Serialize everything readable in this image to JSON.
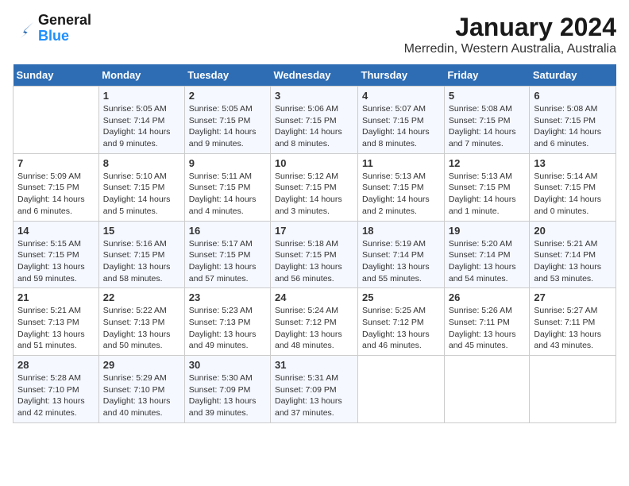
{
  "header": {
    "logo_line1": "General",
    "logo_line2": "Blue",
    "title": "January 2024",
    "subtitle": "Merredin, Western Australia, Australia"
  },
  "days_of_week": [
    "Sunday",
    "Monday",
    "Tuesday",
    "Wednesday",
    "Thursday",
    "Friday",
    "Saturday"
  ],
  "weeks": [
    [
      {
        "num": "",
        "info": ""
      },
      {
        "num": "1",
        "info": "Sunrise: 5:05 AM\nSunset: 7:14 PM\nDaylight: 14 hours\nand 9 minutes."
      },
      {
        "num": "2",
        "info": "Sunrise: 5:05 AM\nSunset: 7:15 PM\nDaylight: 14 hours\nand 9 minutes."
      },
      {
        "num": "3",
        "info": "Sunrise: 5:06 AM\nSunset: 7:15 PM\nDaylight: 14 hours\nand 8 minutes."
      },
      {
        "num": "4",
        "info": "Sunrise: 5:07 AM\nSunset: 7:15 PM\nDaylight: 14 hours\nand 8 minutes."
      },
      {
        "num": "5",
        "info": "Sunrise: 5:08 AM\nSunset: 7:15 PM\nDaylight: 14 hours\nand 7 minutes."
      },
      {
        "num": "6",
        "info": "Sunrise: 5:08 AM\nSunset: 7:15 PM\nDaylight: 14 hours\nand 6 minutes."
      }
    ],
    [
      {
        "num": "7",
        "info": "Sunrise: 5:09 AM\nSunset: 7:15 PM\nDaylight: 14 hours\nand 6 minutes."
      },
      {
        "num": "8",
        "info": "Sunrise: 5:10 AM\nSunset: 7:15 PM\nDaylight: 14 hours\nand 5 minutes."
      },
      {
        "num": "9",
        "info": "Sunrise: 5:11 AM\nSunset: 7:15 PM\nDaylight: 14 hours\nand 4 minutes."
      },
      {
        "num": "10",
        "info": "Sunrise: 5:12 AM\nSunset: 7:15 PM\nDaylight: 14 hours\nand 3 minutes."
      },
      {
        "num": "11",
        "info": "Sunrise: 5:13 AM\nSunset: 7:15 PM\nDaylight: 14 hours\nand 2 minutes."
      },
      {
        "num": "12",
        "info": "Sunrise: 5:13 AM\nSunset: 7:15 PM\nDaylight: 14 hours\nand 1 minute."
      },
      {
        "num": "13",
        "info": "Sunrise: 5:14 AM\nSunset: 7:15 PM\nDaylight: 14 hours\nand 0 minutes."
      }
    ],
    [
      {
        "num": "14",
        "info": "Sunrise: 5:15 AM\nSunset: 7:15 PM\nDaylight: 13 hours\nand 59 minutes."
      },
      {
        "num": "15",
        "info": "Sunrise: 5:16 AM\nSunset: 7:15 PM\nDaylight: 13 hours\nand 58 minutes."
      },
      {
        "num": "16",
        "info": "Sunrise: 5:17 AM\nSunset: 7:15 PM\nDaylight: 13 hours\nand 57 minutes."
      },
      {
        "num": "17",
        "info": "Sunrise: 5:18 AM\nSunset: 7:15 PM\nDaylight: 13 hours\nand 56 minutes."
      },
      {
        "num": "18",
        "info": "Sunrise: 5:19 AM\nSunset: 7:14 PM\nDaylight: 13 hours\nand 55 minutes."
      },
      {
        "num": "19",
        "info": "Sunrise: 5:20 AM\nSunset: 7:14 PM\nDaylight: 13 hours\nand 54 minutes."
      },
      {
        "num": "20",
        "info": "Sunrise: 5:21 AM\nSunset: 7:14 PM\nDaylight: 13 hours\nand 53 minutes."
      }
    ],
    [
      {
        "num": "21",
        "info": "Sunrise: 5:21 AM\nSunset: 7:13 PM\nDaylight: 13 hours\nand 51 minutes."
      },
      {
        "num": "22",
        "info": "Sunrise: 5:22 AM\nSunset: 7:13 PM\nDaylight: 13 hours\nand 50 minutes."
      },
      {
        "num": "23",
        "info": "Sunrise: 5:23 AM\nSunset: 7:13 PM\nDaylight: 13 hours\nand 49 minutes."
      },
      {
        "num": "24",
        "info": "Sunrise: 5:24 AM\nSunset: 7:12 PM\nDaylight: 13 hours\nand 48 minutes."
      },
      {
        "num": "25",
        "info": "Sunrise: 5:25 AM\nSunset: 7:12 PM\nDaylight: 13 hours\nand 46 minutes."
      },
      {
        "num": "26",
        "info": "Sunrise: 5:26 AM\nSunset: 7:11 PM\nDaylight: 13 hours\nand 45 minutes."
      },
      {
        "num": "27",
        "info": "Sunrise: 5:27 AM\nSunset: 7:11 PM\nDaylight: 13 hours\nand 43 minutes."
      }
    ],
    [
      {
        "num": "28",
        "info": "Sunrise: 5:28 AM\nSunset: 7:10 PM\nDaylight: 13 hours\nand 42 minutes."
      },
      {
        "num": "29",
        "info": "Sunrise: 5:29 AM\nSunset: 7:10 PM\nDaylight: 13 hours\nand 40 minutes."
      },
      {
        "num": "30",
        "info": "Sunrise: 5:30 AM\nSunset: 7:09 PM\nDaylight: 13 hours\nand 39 minutes."
      },
      {
        "num": "31",
        "info": "Sunrise: 5:31 AM\nSunset: 7:09 PM\nDaylight: 13 hours\nand 37 minutes."
      },
      {
        "num": "",
        "info": ""
      },
      {
        "num": "",
        "info": ""
      },
      {
        "num": "",
        "info": ""
      }
    ]
  ]
}
